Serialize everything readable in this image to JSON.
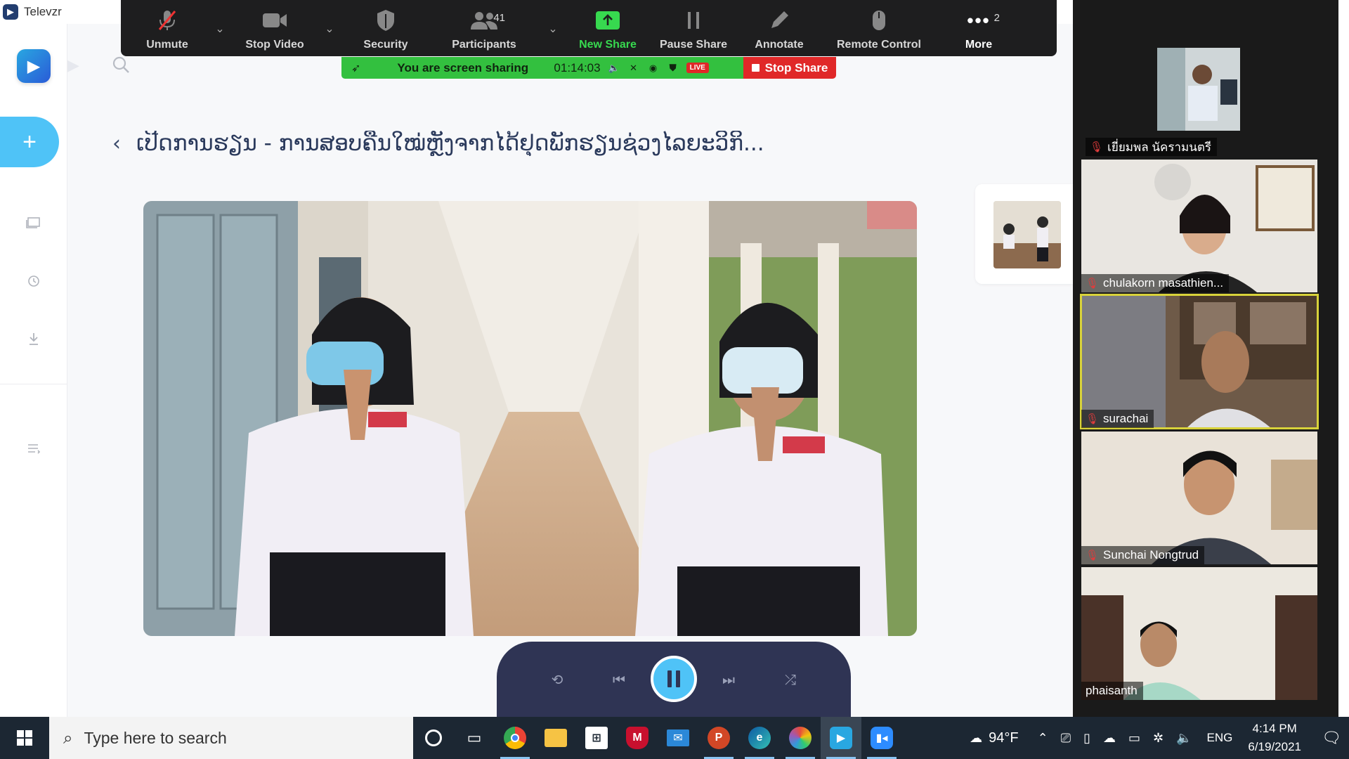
{
  "app": {
    "title": "Televzr",
    "logo_icon": "televzr-logo-icon",
    "page_title": "ເປີດການຮຽນ - ການສອບຄືນໃໝ່ຫຼັງຈາກໄດ້ຢຸດພັກຮຽນຊ່ວງໄລຍະວິກິ...",
    "back_glyph": "‹",
    "sidebar_icons": [
      "add-icon",
      "folder-icon",
      "history-icon",
      "download-icon",
      "playlist-icon"
    ]
  },
  "zoom": {
    "toolbar": [
      {
        "label": "Unmute",
        "icon": "mic-muted-icon"
      },
      {
        "label": "Stop Video",
        "icon": "video-camera-icon"
      },
      {
        "label": "Security",
        "icon": "shield-icon"
      },
      {
        "label": "Participants",
        "icon": "participants-icon",
        "badge": "41"
      },
      {
        "label": "New Share",
        "icon": "new-share-icon"
      },
      {
        "label": "Pause Share",
        "icon": "pause-icon"
      },
      {
        "label": "Annotate",
        "icon": "pencil-icon"
      },
      {
        "label": "Remote Control",
        "icon": "mouse-icon"
      },
      {
        "label": "More",
        "icon": "more-icon",
        "badge": "2"
      }
    ],
    "share_bar": {
      "status": "You are screen sharing",
      "elapsed": "01:14:03",
      "live_badge": "LIVE",
      "stop_label": "Stop Share",
      "colors": {
        "green": "#33c03f",
        "red": "#e02828"
      }
    },
    "participants": [
      {
        "name": "เยี่ยมพล นัครามนตรี",
        "muted": true
      },
      {
        "name": "chulakorn masathien...",
        "muted": true
      },
      {
        "name": "surachai",
        "muted": true,
        "active_speaker": true
      },
      {
        "name": "Sunchai Nongtrud",
        "muted": true
      },
      {
        "name": "phaisanth",
        "muted": false
      }
    ]
  },
  "player": {
    "controls": [
      "repeat-icon",
      "previous-icon",
      "pause-icon",
      "next-icon",
      "shuffle-icon"
    ],
    "accent": "#4fc3f7",
    "background": "#2f3454"
  },
  "taskbar": {
    "search_placeholder": "Type here to search",
    "apps": [
      "cortana-icon",
      "task-view-icon",
      "chrome-icon",
      "file-explorer-icon",
      "store-icon",
      "mcafee-icon",
      "mail-icon",
      "powerpoint-icon",
      "edge-icon",
      "photoscape-icon",
      "televzr-icon",
      "zoom-icon"
    ],
    "weather": "94°F",
    "language": "ENG",
    "time": "4:14 PM",
    "date": "6/19/2021"
  }
}
